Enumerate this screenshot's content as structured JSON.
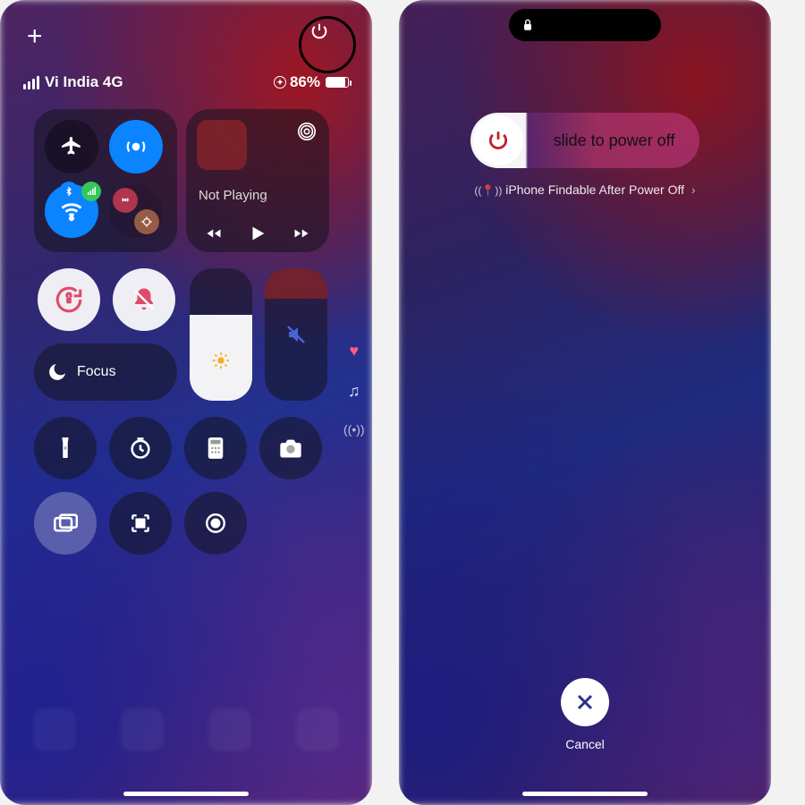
{
  "left": {
    "plus": "+",
    "power_icon": "power-icon",
    "status": {
      "carrier": "Vi India 4G",
      "battery_pct": "86%"
    },
    "connectivity": {
      "airplane": "airplane-mode",
      "airdrop": "airdrop",
      "wifi": "wifi",
      "cellular": "cellular-data",
      "bluetooth": "bluetooth",
      "hotspot": "personal-hotspot",
      "satellite": "satellite"
    },
    "media": {
      "not_playing": "Not Playing"
    },
    "focus_label": "Focus",
    "side": {
      "favorite": "heart",
      "music": "music-note",
      "airdrop_waves": "sound-recognition"
    },
    "tools": {
      "flashlight": "flashlight",
      "timer": "timer",
      "calculator": "calculator",
      "camera": "camera",
      "mirror": "screen-mirroring",
      "qr": "code-scanner",
      "record": "screen-record"
    }
  },
  "right": {
    "slide_label": "slide to power off",
    "findable": "iPhone Findable After Power Off",
    "cancel": "Cancel"
  },
  "colors": {
    "accent_blue": "#0a84ff",
    "accent_green": "#34c759",
    "power_red": "#c0202b"
  }
}
